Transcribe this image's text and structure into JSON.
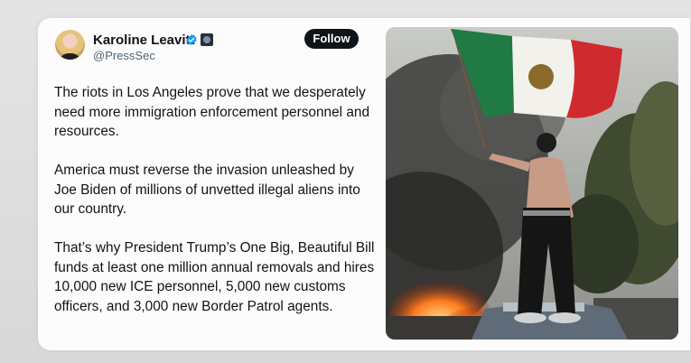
{
  "tweet": {
    "author_name": "Karoline Leavitt",
    "handle": "@PressSec",
    "follow_label": "Follow",
    "paragraphs": [
      "The riots in Los Angeles prove that we desperately need more immigration enforcement personnel and resources.",
      "America must reverse the invasion unleashed by Joe Biden of millions of unvetted illegal aliens into our country.",
      "That’s why President Trump’s One Big, Beautiful Bill funds at least one million annual removals and hires 10,000 new ICE personnel, 5,000 new customs officers, and 3,000 new Border Patrol agents."
    ]
  },
  "icons": {
    "verified": "verified-checkmark-icon",
    "affiliation": "government-affiliation-badge-icon"
  },
  "colors": {
    "verified_blue": "#1d9bf0",
    "follow_button": "#0f1419",
    "text_primary": "#0f1419",
    "text_secondary": "#536471"
  }
}
